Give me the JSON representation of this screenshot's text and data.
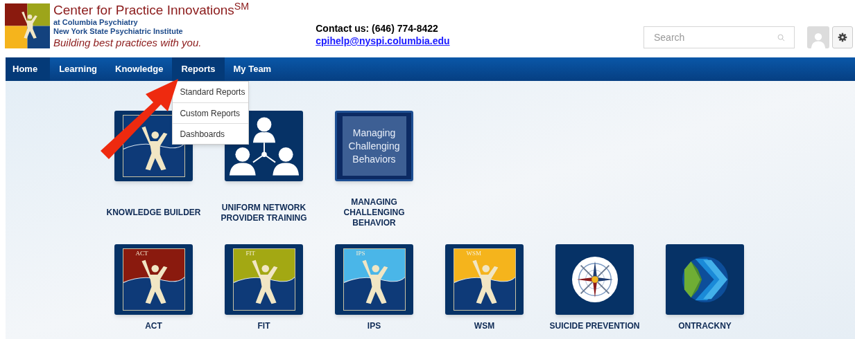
{
  "header": {
    "title": "Center for Practice Innovations",
    "title_mark": "SM",
    "subtitle_lines": [
      "at Columbia Psychiatry",
      "New York State Psychiatric Institute"
    ],
    "tagline": "Building best practices with you.",
    "contact": "Contact us: (646) 774-8422",
    "email": "cpihelp@nyspi.columbia.edu",
    "search": {
      "placeholder": "Search"
    }
  },
  "nav": [
    {
      "label": "Home",
      "highlighted": true
    },
    {
      "label": "Learning",
      "highlighted": false
    },
    {
      "label": "Knowledge",
      "highlighted": false
    },
    {
      "label": "Reports",
      "highlighted": true,
      "menu": [
        "Standard Reports",
        "Custom Reports",
        "Dashboards"
      ]
    },
    {
      "label": "My Team",
      "highlighted": false
    }
  ],
  "tiles": [
    [
      {
        "kind": "logo",
        "label": "KNOWLEDGE BUILDER",
        "color": "#0b3b7a"
      },
      {
        "kind": "people",
        "label": "UNIFORM NETWORK PROVIDER TRAINING"
      },
      {
        "kind": "text",
        "label": "MANAGING CHALLENGING BEHAVIOR",
        "tile_text": "Managing Challenging Behaviors"
      }
    ],
    [
      {
        "kind": "logo",
        "label": "ACT",
        "badge": "ACT",
        "color": "#8a1a0e"
      },
      {
        "kind": "logo",
        "label": "FIT",
        "badge": "FIT",
        "color": "#a3a813"
      },
      {
        "kind": "logo",
        "label": "IPS",
        "badge": "IPS",
        "color": "#4ab6e8"
      },
      {
        "kind": "logo",
        "label": "WSM",
        "badge": "WSM",
        "color": "#f5b41c"
      },
      {
        "kind": "compass",
        "label": "SUICIDE PREVENTION"
      },
      {
        "kind": "chevron",
        "label": "ONTRACKNY"
      }
    ]
  ]
}
